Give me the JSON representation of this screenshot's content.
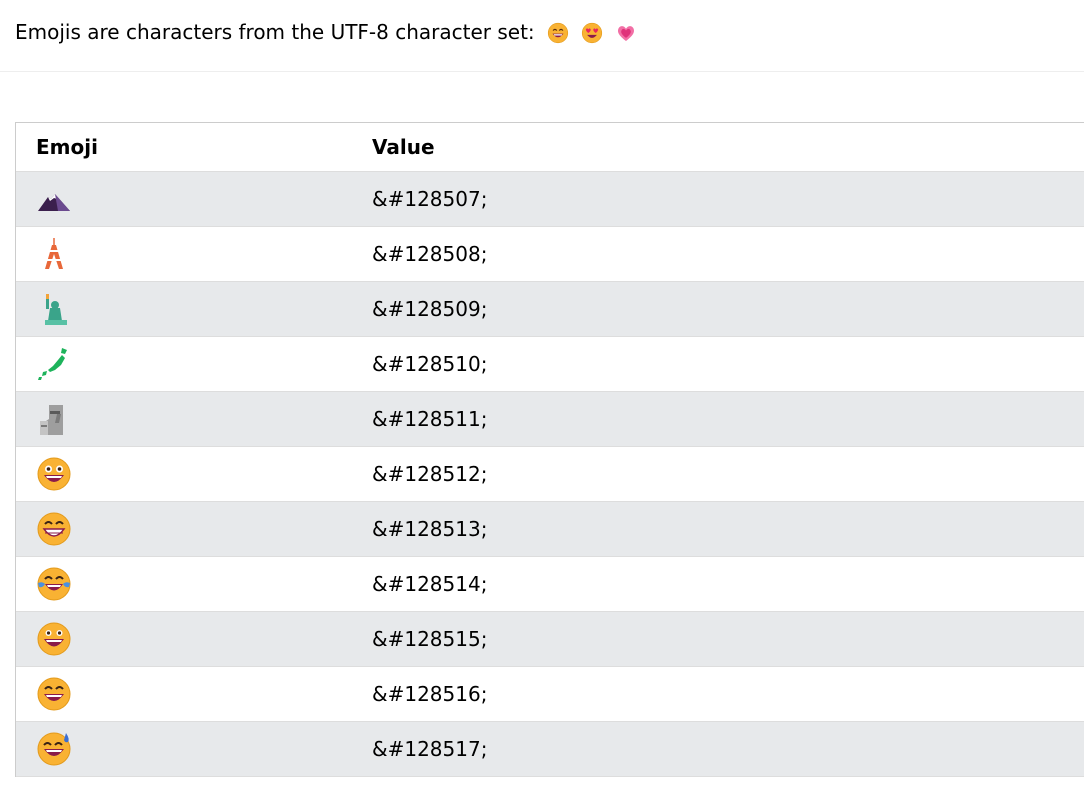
{
  "intro": {
    "text": "Emojis are characters from the UTF-8 character set:",
    "samples": [
      "grinning-smiling-eyes-icon",
      "heart-eyes-icon",
      "growing-heart-icon"
    ]
  },
  "table": {
    "headers": {
      "emoji": "Emoji",
      "value": "Value"
    },
    "rows": [
      {
        "icon": "mount-fuji-icon",
        "value": "&#128507;"
      },
      {
        "icon": "tokyo-tower-icon",
        "value": "&#128508;"
      },
      {
        "icon": "statue-of-liberty-icon",
        "value": "&#128509;"
      },
      {
        "icon": "map-of-japan-icon",
        "value": "&#128510;"
      },
      {
        "icon": "moai-icon",
        "value": "&#128511;"
      },
      {
        "icon": "grinning-face-icon",
        "value": "&#128512;"
      },
      {
        "icon": "beaming-face-icon",
        "value": "&#128513;"
      },
      {
        "icon": "tears-of-joy-icon",
        "value": "&#128514;"
      },
      {
        "icon": "grinning-big-eyes-icon",
        "value": "&#128515;"
      },
      {
        "icon": "grinning-smiling-eyes-icon",
        "value": "&#128516;"
      },
      {
        "icon": "grinning-sweat-icon",
        "value": "&#128517;"
      }
    ]
  },
  "colors": {
    "row_alt": "#e7e9eb",
    "border": "#cccccc",
    "face": "#f9b233"
  }
}
